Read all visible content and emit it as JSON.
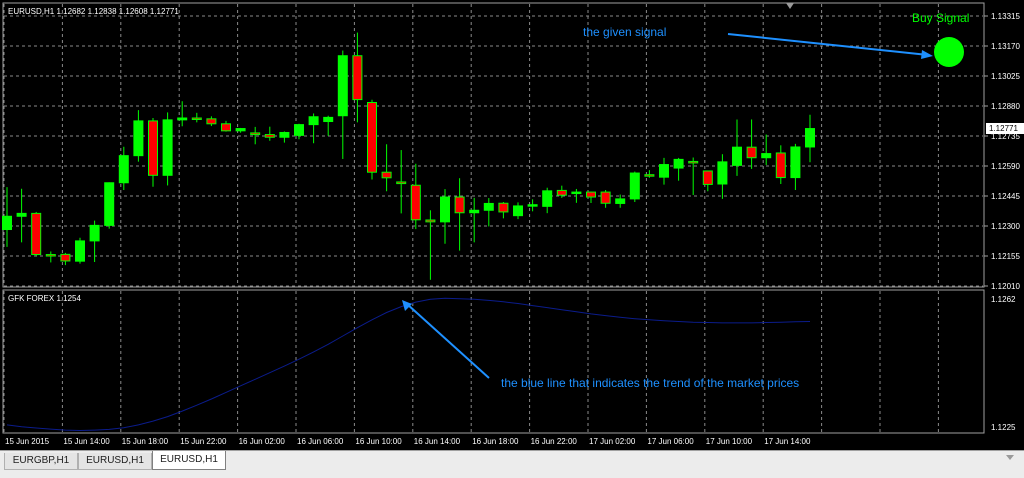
{
  "main_chart": {
    "title": "EURUSD,H1  1.12682 1.12838 1.12608 1.12771",
    "current_price": "1.12771",
    "price_ticks": [
      "1.13315",
      "1.13170",
      "1.13025",
      "1.12880",
      "1.12735",
      "1.12590",
      "1.12445",
      "1.12300",
      "1.12155",
      "1.12010"
    ]
  },
  "indicator": {
    "title": "GFK FOREX 1.1254",
    "ticks": [
      "1.1262",
      "1.1225"
    ]
  },
  "time_ticks": [
    "15 Jun 2015",
    "15 Jun 14:00",
    "15 Jun 18:00",
    "15 Jun 22:00",
    "16 Jun 02:00",
    "16 Jun 06:00",
    "16 Jun 10:00",
    "16 Jun 14:00",
    "16 Jun 18:00",
    "16 Jun 22:00",
    "17 Jun 02:00",
    "17 Jun 06:00",
    "17 Jun 10:00",
    "17 Jun 14:00"
  ],
  "annotations": {
    "signal_label": "Buy Signal",
    "given_signal": "the given signal",
    "blue_line": "the blue line that indicates the trend of the market prices"
  },
  "colors": {
    "bull": "#00ff00",
    "bear": "#ff0000",
    "grid": "#8a8a8a",
    "indicator_line": "#0b1c8c",
    "annotation": "#1e90ff",
    "signal": "#00ff00"
  },
  "tabs": [
    {
      "label": "EURGBP,H1",
      "active": false
    },
    {
      "label": "EURUSD,H1",
      "active": false
    },
    {
      "label": "EURUSD,H1",
      "active": true
    }
  ],
  "chart_data": {
    "type": "candlestick",
    "series": [
      {
        "name": "EURUSD,H1",
        "candles": [
          {
            "o": 1.12283,
            "h": 1.12488,
            "l": 1.12199,
            "c": 1.12347
          },
          {
            "o": 1.12347,
            "h": 1.1248,
            "l": 1.12221,
            "c": 1.12361
          },
          {
            "o": 1.12361,
            "h": 1.12368,
            "l": 1.12155,
            "c": 1.12162
          },
          {
            "o": 1.12162,
            "h": 1.12177,
            "l": 1.12124,
            "c": 1.12158
          },
          {
            "o": 1.12163,
            "h": 1.1217,
            "l": 1.12111,
            "c": 1.12131
          },
          {
            "o": 1.1213,
            "h": 1.12243,
            "l": 1.12118,
            "c": 1.12228
          },
          {
            "o": 1.12228,
            "h": 1.12326,
            "l": 1.12126,
            "c": 1.12303
          },
          {
            "o": 1.12303,
            "h": 1.12511,
            "l": 1.12287,
            "c": 1.12509
          },
          {
            "o": 1.12509,
            "h": 1.12683,
            "l": 1.12474,
            "c": 1.1264
          },
          {
            "o": 1.1264,
            "h": 1.1286,
            "l": 1.12611,
            "c": 1.12808
          },
          {
            "o": 1.12808,
            "h": 1.12822,
            "l": 1.1249,
            "c": 1.12545
          },
          {
            "o": 1.12545,
            "h": 1.12849,
            "l": 1.12496,
            "c": 1.12813
          },
          {
            "o": 1.12813,
            "h": 1.12903,
            "l": 1.12782,
            "c": 1.12822
          },
          {
            "o": 1.12822,
            "h": 1.12847,
            "l": 1.12801,
            "c": 1.12818
          },
          {
            "o": 1.12818,
            "h": 1.1283,
            "l": 1.12783,
            "c": 1.12794
          },
          {
            "o": 1.12794,
            "h": 1.12808,
            "l": 1.12756,
            "c": 1.1276
          },
          {
            "o": 1.1276,
            "h": 1.12774,
            "l": 1.12751,
            "c": 1.12771
          },
          {
            "o": 1.1275,
            "h": 1.12779,
            "l": 1.12695,
            "c": 1.12742
          },
          {
            "o": 1.12742,
            "h": 1.1278,
            "l": 1.12712,
            "c": 1.12729
          },
          {
            "o": 1.12729,
            "h": 1.12757,
            "l": 1.12703,
            "c": 1.12752
          },
          {
            "o": 1.12738,
            "h": 1.12794,
            "l": 1.12719,
            "c": 1.1279
          },
          {
            "o": 1.1279,
            "h": 1.12844,
            "l": 1.127,
            "c": 1.12828
          },
          {
            "o": 1.12805,
            "h": 1.12833,
            "l": 1.12736,
            "c": 1.12825
          },
          {
            "o": 1.12833,
            "h": 1.13148,
            "l": 1.12624,
            "c": 1.13123
          },
          {
            "o": 1.13123,
            "h": 1.13235,
            "l": 1.12801,
            "c": 1.12911
          },
          {
            "o": 1.12897,
            "h": 1.1291,
            "l": 1.12525,
            "c": 1.1256
          },
          {
            "o": 1.1256,
            "h": 1.12695,
            "l": 1.12468,
            "c": 1.12533
          },
          {
            "o": 1.12513,
            "h": 1.12667,
            "l": 1.12361,
            "c": 1.12505
          },
          {
            "o": 1.12497,
            "h": 1.12601,
            "l": 1.12285,
            "c": 1.1233
          },
          {
            "o": 1.12329,
            "h": 1.12376,
            "l": 1.1204,
            "c": 1.1232
          },
          {
            "o": 1.1232,
            "h": 1.12478,
            "l": 1.12214,
            "c": 1.1244
          },
          {
            "o": 1.1244,
            "h": 1.12531,
            "l": 1.12181,
            "c": 1.12364
          },
          {
            "o": 1.12364,
            "h": 1.12436,
            "l": 1.12221,
            "c": 1.12376
          },
          {
            "o": 1.12376,
            "h": 1.12435,
            "l": 1.12298,
            "c": 1.12409
          },
          {
            "o": 1.1241,
            "h": 1.12416,
            "l": 1.12337,
            "c": 1.12368
          },
          {
            "o": 1.1235,
            "h": 1.12414,
            "l": 1.12333,
            "c": 1.12397
          },
          {
            "o": 1.12397,
            "h": 1.12429,
            "l": 1.12371,
            "c": 1.12403
          },
          {
            "o": 1.12395,
            "h": 1.12485,
            "l": 1.12362,
            "c": 1.1247
          },
          {
            "o": 1.12472,
            "h": 1.12495,
            "l": 1.12436,
            "c": 1.12449
          },
          {
            "o": 1.12459,
            "h": 1.12479,
            "l": 1.12412,
            "c": 1.12464
          },
          {
            "o": 1.12464,
            "h": 1.12467,
            "l": 1.12411,
            "c": 1.1244
          },
          {
            "o": 1.12464,
            "h": 1.12474,
            "l": 1.12388,
            "c": 1.1241
          },
          {
            "o": 1.12409,
            "h": 1.12452,
            "l": 1.12388,
            "c": 1.12431
          },
          {
            "o": 1.12431,
            "h": 1.12563,
            "l": 1.12416,
            "c": 1.12556
          },
          {
            "o": 1.12548,
            "h": 1.1257,
            "l": 1.12533,
            "c": 1.12541
          },
          {
            "o": 1.12536,
            "h": 1.12629,
            "l": 1.125,
            "c": 1.12597
          },
          {
            "o": 1.1258,
            "h": 1.12629,
            "l": 1.12519,
            "c": 1.12622
          },
          {
            "o": 1.12612,
            "h": 1.12631,
            "l": 1.1245,
            "c": 1.12607
          },
          {
            "o": 1.12566,
            "h": 1.12556,
            "l": 1.12468,
            "c": 1.12501
          },
          {
            "o": 1.12503,
            "h": 1.12647,
            "l": 1.12431,
            "c": 1.1261
          },
          {
            "o": 1.12593,
            "h": 1.12815,
            "l": 1.12542,
            "c": 1.12681
          },
          {
            "o": 1.12681,
            "h": 1.12815,
            "l": 1.12576,
            "c": 1.1263
          },
          {
            "o": 1.1263,
            "h": 1.12742,
            "l": 1.12595,
            "c": 1.1265
          },
          {
            "o": 1.12653,
            "h": 1.1269,
            "l": 1.12503,
            "c": 1.12534
          },
          {
            "o": 1.12534,
            "h": 1.12697,
            "l": 1.12474,
            "c": 1.12682
          },
          {
            "o": 1.12682,
            "h": 1.12838,
            "l": 1.12608,
            "c": 1.12771
          }
        ]
      },
      {
        "name": "GFK FOREX",
        "values": [
          1.12256,
          1.12251,
          1.12247,
          1.12244,
          1.12241,
          1.1224,
          1.12241,
          1.12243,
          1.12248,
          1.12256,
          1.12267,
          1.1228,
          1.12296,
          1.12313,
          1.12331,
          1.1235,
          1.12369,
          1.12388,
          1.12407,
          1.12426,
          1.12446,
          1.12467,
          1.12489,
          1.12513,
          1.12537,
          1.1256,
          1.12581,
          1.12598,
          1.12611,
          1.12619,
          1.12622,
          1.12621,
          1.12619,
          1.12616,
          1.12612,
          1.12607,
          1.12601,
          1.12595,
          1.12589,
          1.12583,
          1.12577,
          1.12572,
          1.12567,
          1.12563,
          1.1256,
          1.12557,
          1.12555,
          1.12553,
          1.12552,
          1.12551,
          1.12551,
          1.12551,
          1.12552,
          1.12553,
          1.12554,
          1.12555
        ]
      }
    ],
    "ylim_main": [
      1.1201,
      1.13315
    ],
    "ylim_indicator": [
      1.1225,
      1.1262
    ],
    "grid": true
  }
}
